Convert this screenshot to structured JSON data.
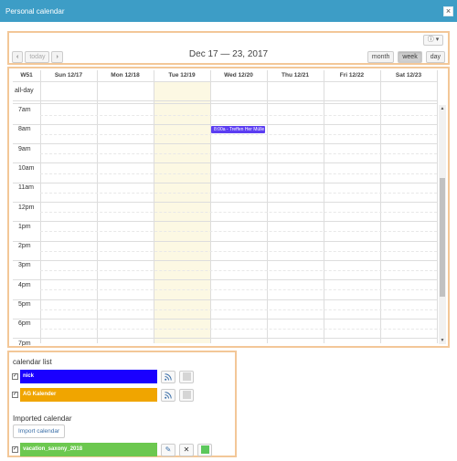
{
  "window": {
    "title": "Personal calendar",
    "close_glyph": "×"
  },
  "toolbar": {
    "help_label": "ⓘ ▾",
    "prev_glyph": "‹",
    "next_glyph": "›",
    "today_label": "today",
    "date_range": "Dec 17 — 23, 2017",
    "views": [
      "month",
      "week",
      "day"
    ],
    "active_view": "week"
  },
  "calendar": {
    "week_label": "W51",
    "allday_label": "all-day",
    "days": [
      "Sun 12/17",
      "Mon 12/18",
      "Tue 12/19",
      "Wed 12/20",
      "Thu 12/21",
      "Fri 12/22",
      "Sat 12/23"
    ],
    "today_index": 2,
    "hours": [
      "7am",
      "8am",
      "9am",
      "10am",
      "11am",
      "12pm",
      "1pm",
      "2pm",
      "3pm",
      "4pm",
      "5pm",
      "6pm",
      "7pm"
    ],
    "events": [
      {
        "title": "8:00a - Treffen Her Mülle",
        "day_index": 3,
        "start_hour_index": 1,
        "color": "#5b3df2"
      }
    ],
    "today_color": "#fcf8e3"
  },
  "calendar_list": {
    "heading": "calendar list",
    "items": [
      {
        "name": "nick",
        "color": "#1a00ff",
        "checked": true,
        "feed_icon": "rss-icon",
        "swatch_color": "#d5d5d5"
      },
      {
        "name": "AG Kalender",
        "color": "#f0a500",
        "checked": true,
        "feed_icon": "rss-icon",
        "swatch_color": "#d5d5d5"
      }
    ]
  },
  "imported": {
    "heading": "Imported calendar",
    "import_button": "Import calendar",
    "items": [
      {
        "name": "vacation_saxony_2018",
        "color": "#6cc84f",
        "checked": true,
        "edit_glyph": "✎",
        "delete_glyph": "✕",
        "swatch_color": "#5cc85c"
      }
    ]
  },
  "accent": {
    "titlebar": "#3d9dc6",
    "panel_border": "#f3c798"
  }
}
